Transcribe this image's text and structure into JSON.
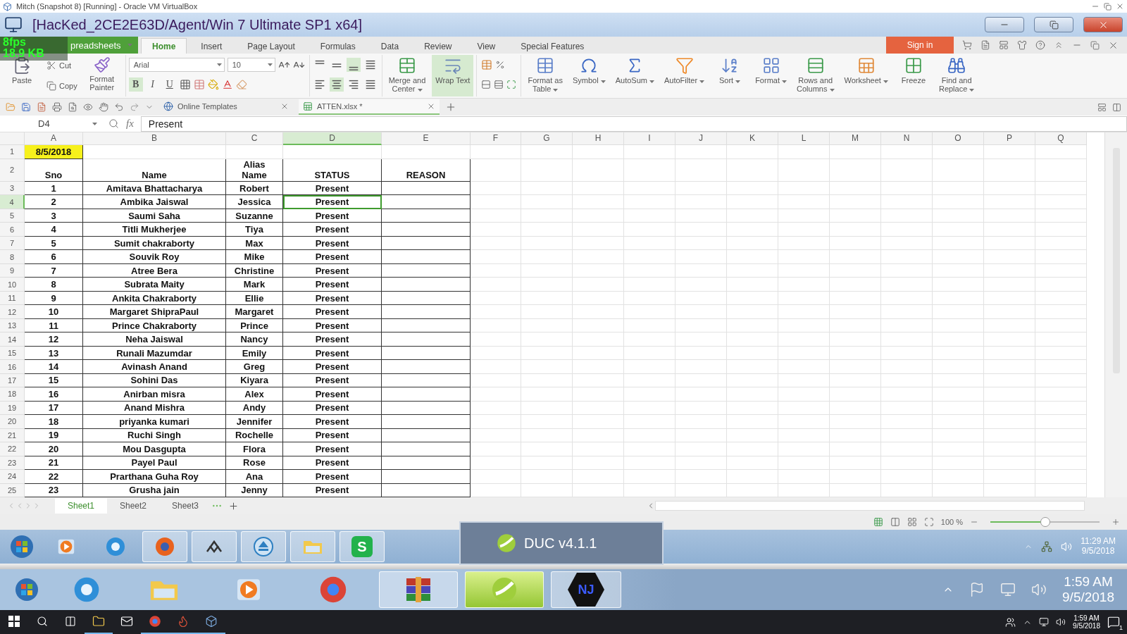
{
  "host_window": {
    "title": "Mitch (Snapshot 8) [Running] - Oracle VM VirtualBox"
  },
  "vm_window": {
    "title": "[HacKed_2CE2E63D/Agent/Win 7 Ultimate SP1 x64]"
  },
  "stats_overlay": [
    "8fps",
    "18.9 KB"
  ],
  "app_menu": {
    "label": "preadsheets"
  },
  "tabs": [
    {
      "label": "Home",
      "selected": true
    },
    {
      "label": "Insert",
      "selected": false
    },
    {
      "label": "Page Layout",
      "selected": false
    },
    {
      "label": "Formulas",
      "selected": false
    },
    {
      "label": "Data",
      "selected": false
    },
    {
      "label": "Review",
      "selected": false
    },
    {
      "label": "View",
      "selected": false
    },
    {
      "label": "Special Features",
      "selected": false
    }
  ],
  "sign_in": {
    "label": "Sign in"
  },
  "ribbon": {
    "paste": {
      "label": "Paste"
    },
    "cut": {
      "label": "Cut"
    },
    "copy": {
      "label": "Copy"
    },
    "format_painter": {
      "lines": [
        "Format",
        "Painter"
      ]
    },
    "font": {
      "value": "Arial"
    },
    "font_size": {
      "value": "10"
    },
    "styles": [
      {
        "label": "B",
        "selected": true
      },
      {
        "label": "I",
        "selected": false
      },
      {
        "label": "U",
        "selected": false
      }
    ],
    "vertical_align": [
      {
        "selected": false
      },
      {
        "selected": false
      },
      {
        "selected": true
      }
    ],
    "horizontal_align": [
      {
        "selected": false
      },
      {
        "selected": true
      },
      {
        "selected": false
      },
      {
        "selected": false
      }
    ],
    "large_buttons": [
      {
        "lines": [
          "Merge and",
          "Center"
        ],
        "dropdown": true,
        "selected": false
      },
      {
        "lines": [
          "Wrap Text"
        ],
        "dropdown": false,
        "selected": true
      },
      {
        "lines": [
          "Format as",
          "Table"
        ],
        "dropdown": true,
        "selected": false
      },
      {
        "lines": [
          "Symbol"
        ],
        "dropdown": true,
        "selected": false
      },
      {
        "lines": [
          "AutoSum"
        ],
        "dropdown": true,
        "selected": false
      },
      {
        "lines": [
          "AutoFilter"
        ],
        "dropdown": true,
        "selected": false
      },
      {
        "lines": [
          "Sort"
        ],
        "dropdown": true,
        "selected": false
      },
      {
        "lines": [
          "Format"
        ],
        "dropdown": true,
        "selected": false
      },
      {
        "lines": [
          "Rows and",
          "Columns"
        ],
        "dropdown": true,
        "selected": false
      },
      {
        "lines": [
          "Worksheet"
        ],
        "dropdown": true,
        "selected": false
      },
      {
        "lines": [
          "Freeze"
        ],
        "dropdown": false,
        "selected": false
      },
      {
        "lines": [
          "Find and",
          "Replace"
        ],
        "dropdown": true,
        "selected": false
      }
    ]
  },
  "document_tabs": [
    {
      "label": "Online Templates",
      "selected": false
    },
    {
      "label": "ATTEN.xlsx *",
      "selected": true
    }
  ],
  "formula_bar": {
    "name_box": "D4",
    "fx": "fx",
    "value": "Present"
  },
  "sheet": {
    "columns": [
      {
        "label": "A",
        "selected": false
      },
      {
        "label": "B",
        "selected": false
      },
      {
        "label": "C",
        "selected": false
      },
      {
        "label": "D",
        "selected": true
      },
      {
        "label": "E",
        "selected": false
      },
      {
        "label": "F",
        "selected": false
      },
      {
        "label": "G",
        "selected": false
      },
      {
        "label": "H",
        "selected": false
      },
      {
        "label": "I",
        "selected": false
      },
      {
        "label": "J",
        "selected": false
      },
      {
        "label": "K",
        "selected": false
      },
      {
        "label": "L",
        "selected": false
      },
      {
        "label": "M",
        "selected": false
      },
      {
        "label": "N",
        "selected": false
      },
      {
        "label": "O",
        "selected": false
      },
      {
        "label": "P",
        "selected": false
      },
      {
        "label": "Q",
        "selected": false
      }
    ],
    "rows": [
      {
        "number": "1",
        "kind": "date",
        "selected": false,
        "cells": [
          "8/5/2018"
        ]
      },
      {
        "number": "2",
        "kind": "header",
        "selected": false,
        "cells": [
          "Sno",
          "Name",
          "Alias\nName",
          "STATUS",
          "REASON"
        ]
      },
      {
        "number": "3",
        "kind": "data",
        "selected": false,
        "cells": [
          "1",
          "Amitava Bhattacharya",
          "Robert",
          "Present"
        ]
      },
      {
        "number": "4",
        "kind": "data",
        "selected": true,
        "cells": [
          "2",
          "Ambika Jaiswal",
          "Jessica",
          "Present"
        ]
      },
      {
        "number": "5",
        "kind": "data",
        "selected": false,
        "cells": [
          "3",
          "Saumi Saha",
          "Suzanne",
          "Present"
        ]
      },
      {
        "number": "6",
        "kind": "data",
        "selected": false,
        "cells": [
          "4",
          "Titli Mukherjee",
          "Tiya",
          "Present"
        ]
      },
      {
        "number": "7",
        "kind": "data",
        "selected": false,
        "cells": [
          "5",
          "Sumit chakraborty",
          "Max",
          "Present"
        ]
      },
      {
        "number": "8",
        "kind": "data",
        "selected": false,
        "cells": [
          "6",
          "Souvik Roy",
          "Mike",
          "Present"
        ]
      },
      {
        "number": "9",
        "kind": "data",
        "selected": false,
        "cells": [
          "7",
          "Atree Bera",
          "Christine",
          "Present"
        ]
      },
      {
        "number": "10",
        "kind": "data",
        "selected": false,
        "cells": [
          "8",
          "Subrata Maity",
          "Mark",
          "Present"
        ]
      },
      {
        "number": "11",
        "kind": "data",
        "selected": false,
        "cells": [
          "9",
          "Ankita Chakraborty",
          "Ellie",
          "Present"
        ]
      },
      {
        "number": "12",
        "kind": "data",
        "selected": false,
        "cells": [
          "10",
          "Margaret ShipraPaul",
          "Margaret",
          "Present"
        ]
      },
      {
        "number": "13",
        "kind": "data",
        "selected": false,
        "cells": [
          "11",
          "Prince Chakraborty",
          "Prince",
          "Present"
        ]
      },
      {
        "number": "14",
        "kind": "data",
        "selected": false,
        "cells": [
          "12",
          "Neha Jaiswal",
          "Nancy",
          "Present"
        ]
      },
      {
        "number": "15",
        "kind": "data",
        "selected": false,
        "cells": [
          "13",
          "Runali Mazumdar",
          "Emily",
          "Present"
        ]
      },
      {
        "number": "16",
        "kind": "data",
        "selected": false,
        "cells": [
          "14",
          "Avinash Anand",
          "Greg",
          "Present"
        ]
      },
      {
        "number": "17",
        "kind": "data",
        "selected": false,
        "cells": [
          "15",
          "Sohini Das",
          "Kiyara",
          "Present"
        ]
      },
      {
        "number": "18",
        "kind": "data",
        "selected": false,
        "cells": [
          "16",
          "Anirban misra",
          "Alex",
          "Present"
        ]
      },
      {
        "number": "19",
        "kind": "data",
        "selected": false,
        "cells": [
          "17",
          "Anand Mishra",
          "Andy",
          "Present"
        ]
      },
      {
        "number": "20",
        "kind": "data",
        "selected": false,
        "cells": [
          "18",
          "priyanka kumari",
          "Jennifer",
          "Present"
        ]
      },
      {
        "number": "21",
        "kind": "data",
        "selected": false,
        "cells": [
          "19",
          "Ruchi Singh",
          "Rochelle",
          "Present"
        ]
      },
      {
        "number": "22",
        "kind": "data",
        "selected": false,
        "cells": [
          "20",
          "Mou Dasgupta",
          "Flora",
          "Present"
        ]
      },
      {
        "number": "23",
        "kind": "data",
        "selected": false,
        "cells": [
          "21",
          "Payel Paul",
          "Rose",
          "Present"
        ]
      },
      {
        "number": "24",
        "kind": "data",
        "selected": false,
        "cells": [
          "22",
          "Prarthana Guha Roy",
          "Ana",
          "Present"
        ]
      },
      {
        "number": "25",
        "kind": "data",
        "selected": false,
        "cells": [
          "23",
          "Grusha jain",
          "Jenny",
          "Present"
        ]
      }
    ]
  },
  "sheet_tabs": [
    {
      "label": "Sheet1",
      "selected": true
    },
    {
      "label": "Sheet2",
      "selected": false
    },
    {
      "label": "Sheet3",
      "selected": false
    }
  ],
  "zoom": {
    "reading": "100 %",
    "level": 0.5
  },
  "duc_popup": {
    "title": "DUC v4.1.1"
  },
  "vm_taskbar": {
    "apps": [
      {
        "running": false
      },
      {
        "running": false
      },
      {
        "running": false
      },
      {
        "running": true
      },
      {
        "running": true
      },
      {
        "running": true
      },
      {
        "running": true
      },
      {
        "running": true,
        "glyph": "S"
      }
    ],
    "clock": {
      "time": "11:29 AM",
      "date": "9/5/2018"
    }
  },
  "win7_taskbar": {
    "apps": [
      {
        "running": false,
        "selected": false
      },
      {
        "running": false,
        "selected": false
      },
      {
        "running": false,
        "selected": false
      },
      {
        "running": false,
        "selected": false
      },
      {
        "running": false,
        "selected": false
      },
      {
        "running": true,
        "selected": false
      },
      {
        "running": true,
        "selected": true
      },
      {
        "running": true,
        "selected": false,
        "glyph": "NJ"
      }
    ],
    "clock": {
      "time": "1:59 AM",
      "date": "9/5/2018"
    }
  },
  "win10_taskbar": {
    "apps": [
      {
        "running": false
      },
      {
        "running": false
      },
      {
        "running": false
      },
      {
        "running": true
      },
      {
        "running": false
      },
      {
        "running": true
      },
      {
        "running": true
      },
      {
        "running": true
      }
    ],
    "clock": {
      "time": "1:59 AM",
      "date": "9/5/2018"
    },
    "notifications": "1"
  }
}
